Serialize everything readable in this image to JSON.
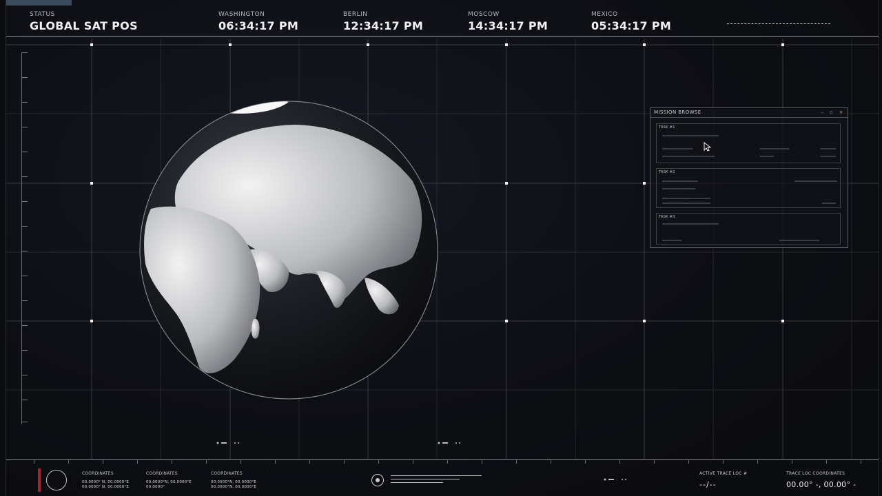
{
  "header": {
    "status": {
      "label": "STATUS",
      "value": "GLOBAL SAT POS"
    },
    "clocks": [
      {
        "city": "WASHINGTON",
        "time": "06:34:17 PM"
      },
      {
        "city": "BERLIN",
        "time": "12:34:17 PM"
      },
      {
        "city": "MOSCOW",
        "time": "14:34:17 PM"
      },
      {
        "city": "MEXICO",
        "time": "05:34:17 PM"
      }
    ]
  },
  "panel": {
    "title": "MISSION BROWSE",
    "controls": [
      "–",
      "▫",
      "×"
    ],
    "tasks": [
      {
        "label": "TASK #1"
      },
      {
        "label": "TASK #2"
      },
      {
        "label": "TASK #3"
      }
    ]
  },
  "footer": {
    "coordinates": [
      {
        "header": "COORDINATES",
        "line1": "00.0000° N, 00.0000°E",
        "line2": "00.0000° N, 00.0000°E"
      },
      {
        "header": "COORDINATES",
        "line1": "00.0000°N, 00.0000°E",
        "line2": "00.0000°"
      },
      {
        "header": "COORDINATES",
        "line1": "00.0000°N, 00.0000°E",
        "line2": "00.0000°N, 00.0000°E"
      }
    ],
    "active_trace": {
      "label": "ACTIVE TRACE LOC #",
      "value": "--/--"
    },
    "trace_coords": {
      "label": "TRACE LOC COORDINATES",
      "value": "00.00° -, 00.00° -"
    }
  },
  "colors": {
    "accent_red": "#9c2a34",
    "grid": "#5b5e66",
    "text": "#e8e8ea"
  },
  "icons": {
    "globe": "earth-globe",
    "cursor": "mouse-cursor-icon",
    "target": "target-icon"
  }
}
